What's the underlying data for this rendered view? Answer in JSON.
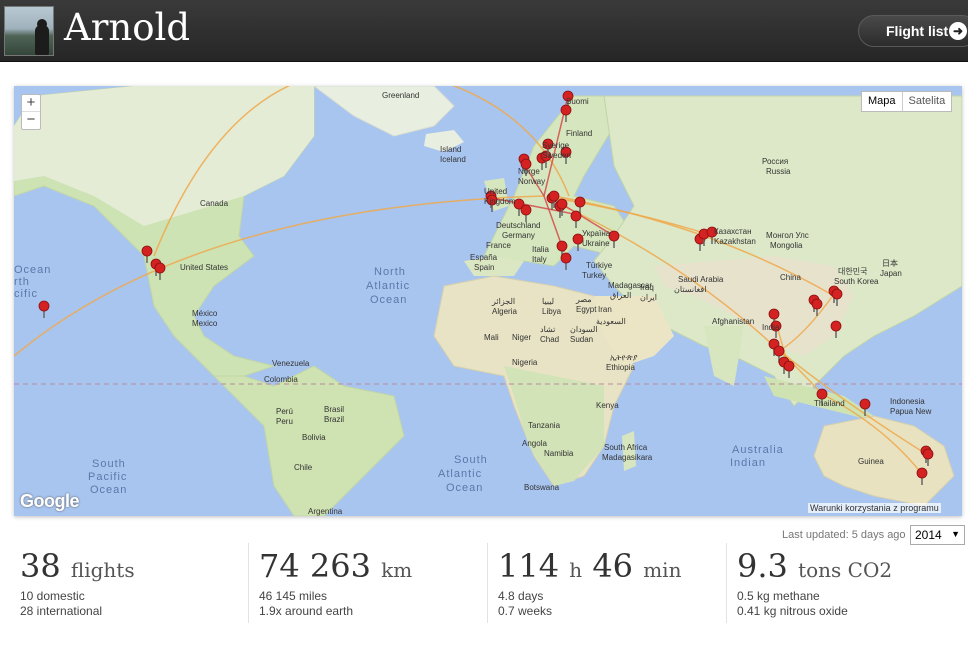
{
  "header": {
    "title": "Arnold",
    "flight_list_label": "Flight list"
  },
  "map": {
    "zoom_in": "+",
    "zoom_out": "−",
    "type_map": "Mapa",
    "type_satellite": "Satelita",
    "google": "Google",
    "terms": "Warunki korzystania z programu",
    "labels": [
      {
        "t": "Greenland"
      },
      {
        "t": "Island"
      },
      {
        "t": "Iceland"
      },
      {
        "t": "Suomi"
      },
      {
        "t": "Finland"
      },
      {
        "t": "Sverige"
      },
      {
        "t": "Sweden"
      },
      {
        "t": "Norge"
      },
      {
        "t": "Norway"
      },
      {
        "t": "United"
      },
      {
        "t": "Kingdom"
      },
      {
        "t": "Deutschland"
      },
      {
        "t": "Germany"
      },
      {
        "t": "France"
      },
      {
        "t": "España"
      },
      {
        "t": "Spain"
      },
      {
        "t": "Italia"
      },
      {
        "t": "Italy"
      },
      {
        "t": "Україна"
      },
      {
        "t": "Ukraine"
      },
      {
        "t": "Türkiye"
      },
      {
        "t": "Turkey"
      },
      {
        "t": "Россия"
      },
      {
        "t": "Russia"
      },
      {
        "t": "Казахстан"
      },
      {
        "t": "Kazakhstan"
      },
      {
        "t": "Монгол Улс"
      },
      {
        "t": "Mongolia"
      },
      {
        "t": "China"
      },
      {
        "t": "日本"
      },
      {
        "t": "Japan"
      },
      {
        "t": "대한민국"
      },
      {
        "t": "South Korea"
      },
      {
        "t": "Canada"
      },
      {
        "t": "United States"
      },
      {
        "t": "México"
      },
      {
        "t": "Mexico"
      },
      {
        "t": "North"
      },
      {
        "t": "Atlantic"
      },
      {
        "t": "Ocean"
      },
      {
        "t": "Venezuela"
      },
      {
        "t": "Colombia"
      },
      {
        "t": "Perú"
      },
      {
        "t": "Peru"
      },
      {
        "t": "Brasil"
      },
      {
        "t": "Brazil"
      },
      {
        "t": "Bolivia"
      },
      {
        "t": "Chile"
      },
      {
        "t": "Argentina"
      },
      {
        "t": "South"
      },
      {
        "t": "Pacific"
      },
      {
        "t": "Ocean"
      },
      {
        "t": "South"
      },
      {
        "t": "Atlantic"
      },
      {
        "t": "Ocean"
      },
      {
        "t": "الجزائر"
      },
      {
        "t": "Algeria"
      },
      {
        "t": "ليبيا"
      },
      {
        "t": "Libya"
      },
      {
        "t": "مصر"
      },
      {
        "t": "Egypt"
      },
      {
        "t": "Mali"
      },
      {
        "t": "Niger"
      },
      {
        "t": "Nigeria"
      },
      {
        "t": "تشاد"
      },
      {
        "t": "Chad"
      },
      {
        "t": "السودان"
      },
      {
        "t": "Sudan"
      },
      {
        "t": "ኢትዮጵያ"
      },
      {
        "t": "Ethiopia"
      },
      {
        "t": "Kenya"
      },
      {
        "t": "Tanzania"
      },
      {
        "t": "Angola"
      },
      {
        "t": "Namibia"
      },
      {
        "t": "Botswana"
      },
      {
        "t": "South Africa"
      },
      {
        "t": "Madagasikara"
      },
      {
        "t": "Madagascar"
      },
      {
        "t": "العراق"
      },
      {
        "t": "Iraq"
      },
      {
        "t": "ایران"
      },
      {
        "t": "Iran"
      },
      {
        "t": "السعودية"
      },
      {
        "t": "Saudi Arabia"
      },
      {
        "t": "افغانستان"
      },
      {
        "t": "Afghanistan"
      },
      {
        "t": "India"
      },
      {
        "t": "Thailand"
      },
      {
        "t": "Indonesia"
      },
      {
        "t": "Papua New"
      },
      {
        "t": "Guinea"
      },
      {
        "t": "Australia"
      },
      {
        "t": "Indian"
      },
      {
        "t": "Ocean"
      },
      {
        "t": "rth"
      },
      {
        "t": "cific"
      },
      {
        "t": "ean"
      }
    ]
  },
  "footer": {
    "last_updated": "Last updated: 5 days ago",
    "year": "2014"
  },
  "stats": {
    "flights": {
      "value": "38",
      "unit": "flights",
      "line1": "10 domestic",
      "line2": "28 international"
    },
    "distance": {
      "value": "74 263",
      "unit": "km",
      "line1": "46 145 miles",
      "line2": "1.9x around earth"
    },
    "time": {
      "hours": "114",
      "h_unit": "h",
      "minutes": "46",
      "m_unit": "min",
      "line1": "4.8 days",
      "line2": "0.7 weeks"
    },
    "co2": {
      "value": "9.3",
      "unit": "tons CO2",
      "line1": "0.5 kg methane",
      "line2": "0.41 kg nitrous oxide"
    }
  }
}
